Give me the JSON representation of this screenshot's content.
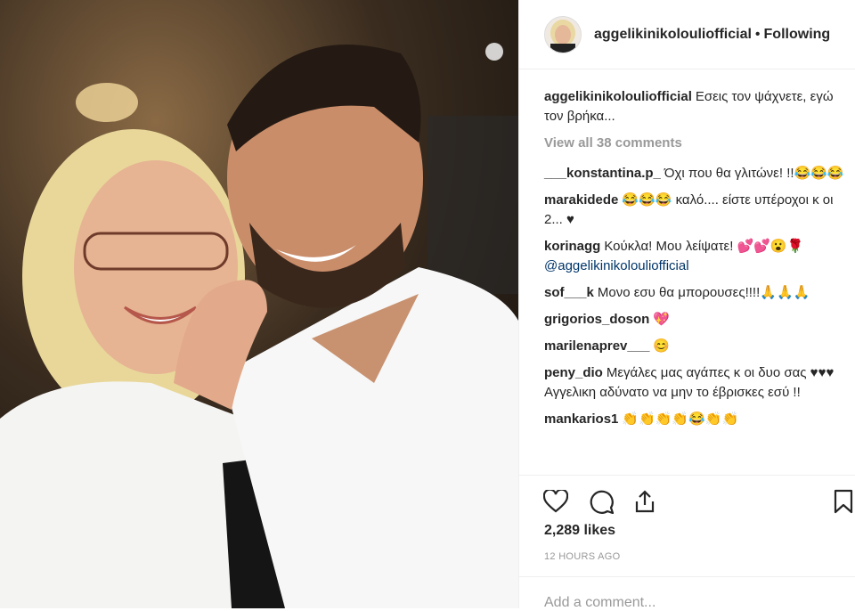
{
  "post": {
    "username": "aggelikinikolouliofficial",
    "separator": "•",
    "follow_status": "Following",
    "caption_user": "aggelikinikolouliofficial",
    "caption_text": "Εσεις τον ψάχνετε, εγώ τον βρήκα...",
    "view_all": "View all 38 comments",
    "likes": "2,289 likes",
    "timestamp": "12 HOURS AGO",
    "add_comment_placeholder": "Add a comment..."
  },
  "comments": [
    {
      "user": "___konstantina.p_",
      "text": "Όχι που θα γλιτώνε! !!😂😂😂"
    },
    {
      "user": "marakidede",
      "text": "😂😂😂 καλό.... είστε υπέροχοι κ οι 2... ♥"
    },
    {
      "user": "korinagg",
      "text": "Κούκλα! Μου λείψατε! 💕💕😮🌹",
      "mention": "@aggelikinikolouliofficial"
    },
    {
      "user": "sof___k",
      "text": "Μονο εσυ θα μπορουσες!!!!🙏🙏🙏"
    },
    {
      "user": "grigorios_doson",
      "text": "💖"
    },
    {
      "user": "marilenaprev___",
      "text": "😊"
    },
    {
      "user": "peny_dio",
      "text": "Μεγάλες μας αγάπες κ οι δυο σας ♥♥♥ Αγγελικη αδύνατο να μην το έβρισκες εσύ !!"
    },
    {
      "user": "mankarios1",
      "text": "👏👏👏👏😂👏👏"
    }
  ],
  "icons": [
    "heart-icon",
    "comment-icon",
    "share-icon",
    "bookmark-icon"
  ]
}
